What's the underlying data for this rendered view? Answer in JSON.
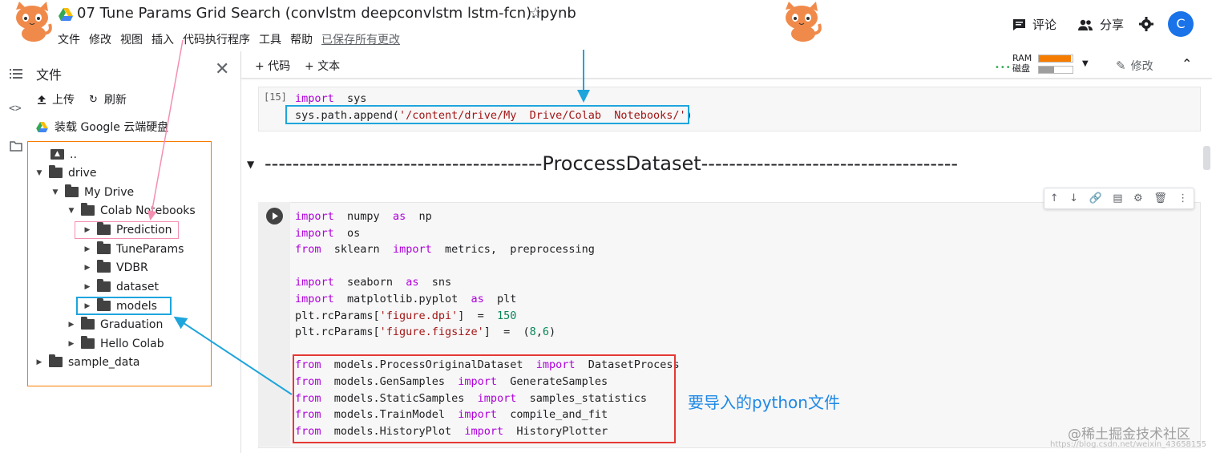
{
  "header": {
    "title": "07 Tune Params Grid Search (convlstm deepconvlstm lstm-fcn).ipynb",
    "menu": [
      "文件",
      "修改",
      "视图",
      "插入",
      "代码执行程序",
      "工具",
      "帮助"
    ],
    "saved_status": "已保存所有更改",
    "comment_label": "评论",
    "share_label": "分享",
    "avatar_letter": "C"
  },
  "filepanel": {
    "title": "文件",
    "upload_label": "上传",
    "refresh_label": "刷新",
    "mount_label": "装载 Google 云端硬盘",
    "tree": {
      "parent": "..",
      "drive": "drive",
      "mydrive": "My Drive",
      "colab": "Colab Notebooks",
      "prediction": "Prediction",
      "tuneparams": "TuneParams",
      "vdbr": "VDBR",
      "dataset": "dataset",
      "models": "models",
      "graduation": "Graduation",
      "hellocolab": "Hello Colab",
      "sample_data": "sample_data"
    }
  },
  "toolbar": {
    "add_code": "+ 代码",
    "add_text": "+ 文本",
    "ram_label": "RAM",
    "disk_label": "磁盘",
    "edit_label": "修改"
  },
  "cell1": {
    "exec_count": "[15]",
    "line1_kw": "import",
    "line1_mod": "sys",
    "line2_pre": "sys.path.append(",
    "line2_str": "'/content/drive/My  Drive/Colab  Notebooks/'",
    "line2_post": ")"
  },
  "section": {
    "title": "----------------------------------------ProccessDataset-------------------------------------"
  },
  "cell2": {
    "l1": [
      "import",
      "numpy",
      "as",
      "np"
    ],
    "l2": [
      "import",
      "os"
    ],
    "l3": [
      "from",
      "sklearn",
      "import",
      "metrics,  preprocessing"
    ],
    "l4": [
      "import",
      "seaborn",
      "as",
      "sns"
    ],
    "l5": [
      "import",
      "matplotlib.pyplot",
      "as",
      "plt"
    ],
    "l6": [
      "plt.rcParams[",
      "'figure.dpi'",
      "]  =  ",
      "150"
    ],
    "l7": [
      "plt.rcParams[",
      "'figure.figsize'",
      "]  =  (",
      "8",
      ",",
      "6",
      ")"
    ],
    "l8": [
      "from",
      "models.ProcessOriginalDataset",
      "import",
      "DatasetProcess"
    ],
    "l9": [
      "from",
      "models.GenSamples",
      "import",
      "GenerateSamples"
    ],
    "l10": [
      "from",
      "models.StaticSamples",
      "import",
      "samples_statistics"
    ],
    "l11": [
      "from",
      "models.TrainModel",
      "import",
      "compile_and_fit"
    ],
    "l12": [
      "from",
      "models.HistoryPlot",
      "import",
      "HistoryPlotter"
    ]
  },
  "annotation": "要导入的python文件",
  "watermark": "@稀土掘金技术社区",
  "watermark_small": "https://blog.csdn.net/weixin_43658155",
  "colors": {
    "keyword": "#af00db",
    "string": "#a31515",
    "number": "#098658",
    "highlight_blue": "#1ea5dc",
    "highlight_red": "#e53935",
    "highlight_pink": "#f48fb1",
    "orange_box": "#f57c00",
    "avatar": "#1a73e8"
  }
}
